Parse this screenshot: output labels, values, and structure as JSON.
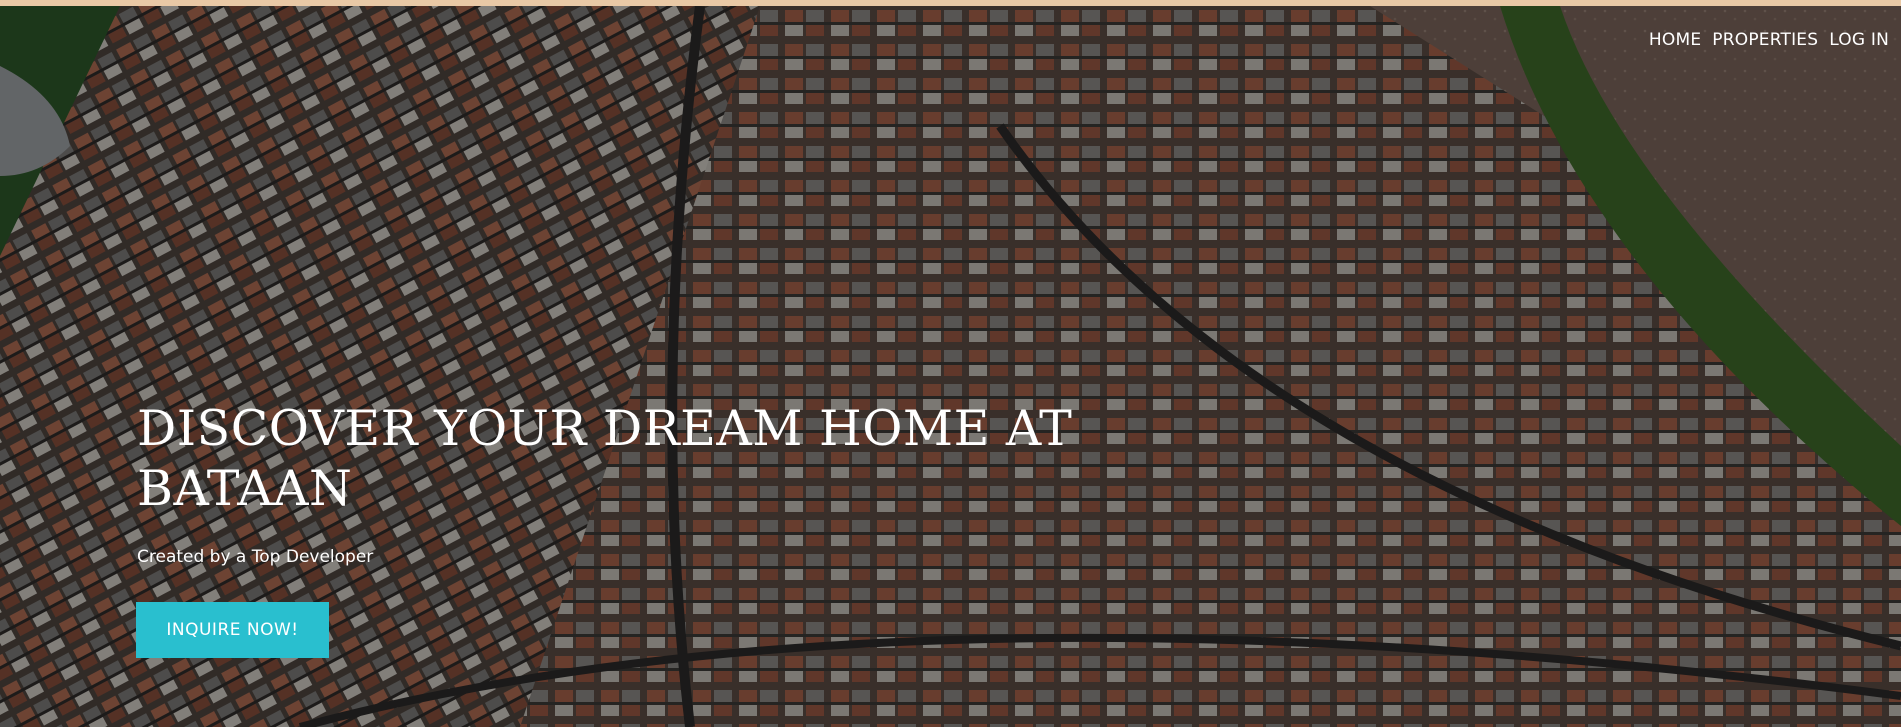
{
  "nav": {
    "items": [
      {
        "label": "HOME"
      },
      {
        "label": "PROPERTIES"
      },
      {
        "label": "LOG IN"
      }
    ]
  },
  "hero": {
    "image": "aerial-housing-estate-photo",
    "headline": "DISCOVER YOUR DREAM HOME AT BATAAN",
    "subheadline": "Created by a Top Developer",
    "cta_label": "INQUIRE NOW!"
  },
  "colors": {
    "top_strip": "#e9c9a6",
    "cta_background": "#29bfcf",
    "text": "#ffffff"
  }
}
